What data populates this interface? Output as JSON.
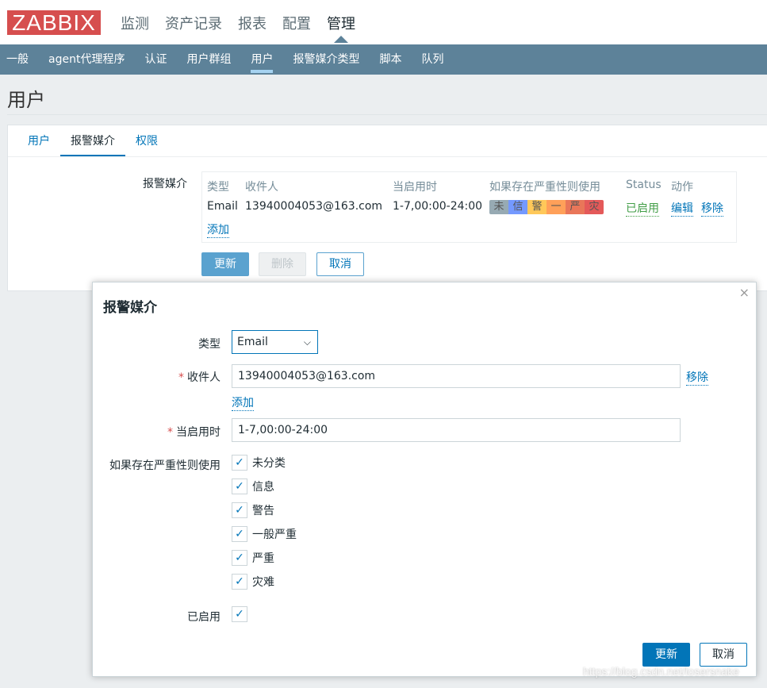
{
  "logo": "ZABBIX",
  "main_nav": [
    "监测",
    "资产记录",
    "报表",
    "配置",
    "管理"
  ],
  "sub_nav": [
    "一般",
    "agent代理程序",
    "认证",
    "用户群组",
    "用户",
    "报警媒介类型",
    "脚本",
    "队列"
  ],
  "page_title": "用户",
  "tabs": [
    "用户",
    "报警媒介",
    "权限"
  ],
  "media": {
    "label": "报警媒介",
    "headers": [
      "类型",
      "收件人",
      "当启用时",
      "如果存在严重性则使用",
      "Status",
      "动作"
    ],
    "row": {
      "type": "Email",
      "to": "13940004053@163.com",
      "when": "1-7,00:00-24:00",
      "severities": [
        {
          "t": "未",
          "c": "#97aab3"
        },
        {
          "t": "信",
          "c": "#7499ff"
        },
        {
          "t": "警",
          "c": "#ffc859"
        },
        {
          "t": "一",
          "c": "#ffa059"
        },
        {
          "t": "严",
          "c": "#e97659"
        },
        {
          "t": "灾",
          "c": "#e45959"
        }
      ],
      "status": "已启用",
      "edit": "编辑",
      "remove": "移除"
    },
    "add": "添加"
  },
  "buttons": {
    "update": "更新",
    "delete": "删除",
    "cancel": "取消"
  },
  "dialog": {
    "title": "报警媒介",
    "close": "×",
    "type_label": "类型",
    "type_value": "Email",
    "to_label": "收件人",
    "to_value": "13940004053@163.com",
    "remove": "移除",
    "add": "添加",
    "when_label": "当启用时",
    "when_value": "1-7,00:00-24:00",
    "sev_label": "如果存在严重性则使用",
    "severities": [
      "未分类",
      "信息",
      "警告",
      "一般严重",
      "严重",
      "灾难"
    ],
    "enabled_label": "已启用",
    "update": "更新",
    "cancel": "取消"
  },
  "watermark": "https://blog.csdn.net/losersnake"
}
